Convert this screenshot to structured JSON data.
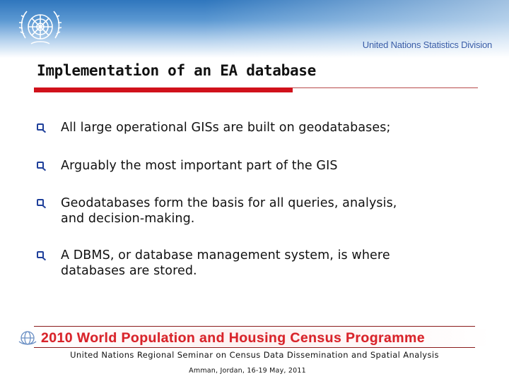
{
  "header": {
    "organization": "United Nations Statistics Division",
    "logo_icon": "un-emblem-icon",
    "band_color": "#2f76bd"
  },
  "slide": {
    "title": "Implementation of an EA database",
    "bullet_icon": "checkbox-square-icon",
    "bullets": [
      {
        "lines": [
          "All large operational GISs are built on geodatabases;"
        ]
      },
      {
        "lines": [
          "Arguably the most important part of the GIS"
        ]
      },
      {
        "lines": [
          "Geodatabases form the basis for all queries, analysis,",
          "and decision-making."
        ]
      },
      {
        "lines": [
          "A DBMS, or database management system, is where",
          "databases are stored."
        ]
      }
    ],
    "accent_color": "#d0111b",
    "bullet_color": "#1e3f9a"
  },
  "footer": {
    "programme_banner": "2010 World Population and Housing Census Programme",
    "programme_icon": "census-globe-icon",
    "seminar": "United Nations Regional Seminar on Census Data Dissemination and Spatial Analysis",
    "venue": "Amman, Jordan, 16-19 May, 2011",
    "banner_color": "#d8232a"
  }
}
